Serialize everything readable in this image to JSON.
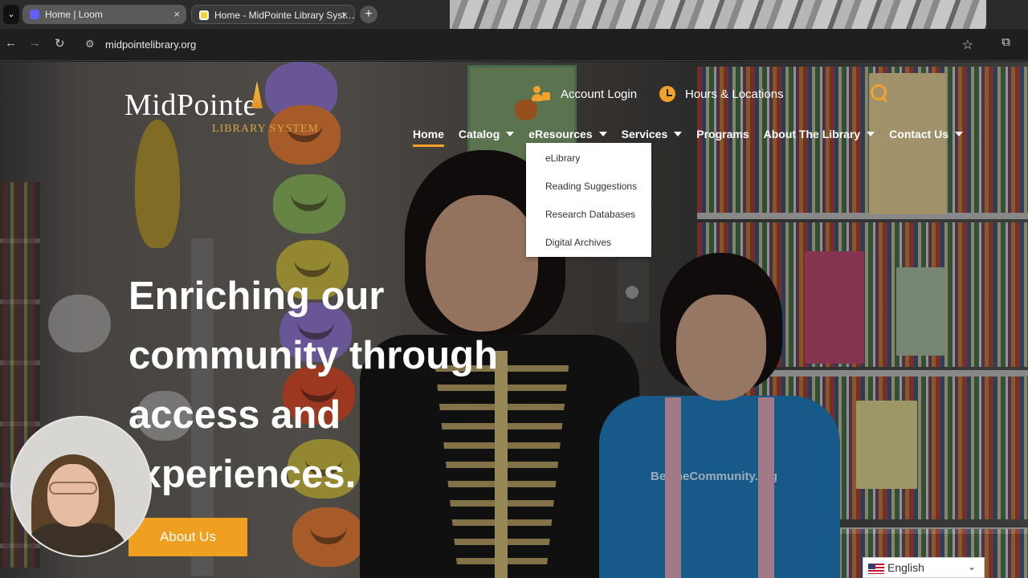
{
  "browser": {
    "tabs": [
      {
        "title": "Home | Loom",
        "active": false
      },
      {
        "title": "Home - MidPointe Library Syst…",
        "active": true
      }
    ],
    "new_tab_label": "+",
    "tab_close_label": "×",
    "url": "midpointelibrary.org"
  },
  "site": {
    "logo_main": "MidPointe",
    "logo_sub": "LIBRARY SYSTEM",
    "utility": {
      "account_login": "Account Login",
      "hours_locations": "Hours & Locations"
    },
    "nav": [
      {
        "label": "Home",
        "has_dropdown": false
      },
      {
        "label": "Catalog",
        "has_dropdown": true
      },
      {
        "label": "eResources",
        "has_dropdown": true
      },
      {
        "label": "Services",
        "has_dropdown": true
      },
      {
        "label": "Programs",
        "has_dropdown": false
      },
      {
        "label": "About The Library",
        "has_dropdown": true
      },
      {
        "label": "Contact Us",
        "has_dropdown": true
      }
    ],
    "eresources_menu": [
      "eLibrary",
      "Reading Suggestions",
      "Research Databases",
      "Digital Archives"
    ],
    "hero": {
      "line1": "Enriching our",
      "line2": "community through",
      "line3": "access and",
      "line4": " xperiences."
    },
    "about_button": "About Us",
    "shirt_text": "BeOneCommunity.org",
    "language": "English"
  },
  "colors": {
    "accent": "#F0A020",
    "logo_gold": "#D7A441",
    "chrome_dark": "#1F1F1F"
  },
  "icons": [
    "back-icon",
    "forward-icon",
    "reload-icon",
    "site-info-icon",
    "bookmark-star-icon",
    "extensions-icon",
    "user-lock-icon",
    "clock-icon",
    "search-icon",
    "us-flag-icon"
  ]
}
